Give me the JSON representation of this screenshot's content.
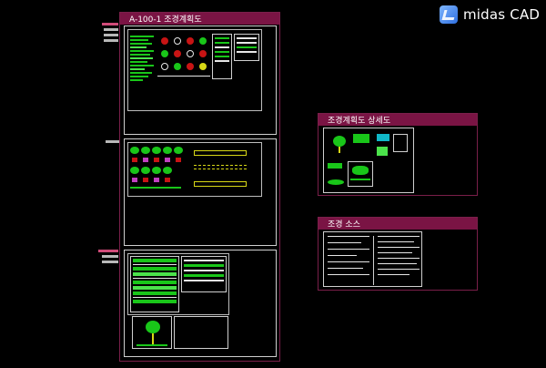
{
  "app": {
    "brand": "midas CAD"
  },
  "groups": [
    {
      "title": "A-100-1 조경계획도"
    },
    {
      "title": "조경계획도 상세도"
    },
    {
      "title": "조경 소스"
    }
  ],
  "colors": {
    "accent": "#7a1444",
    "frame": "#7a1f4a",
    "cad_green": "#19c619",
    "cad_red": "#c81414",
    "cad_yellow": "#d8d816",
    "background": "#000000"
  }
}
